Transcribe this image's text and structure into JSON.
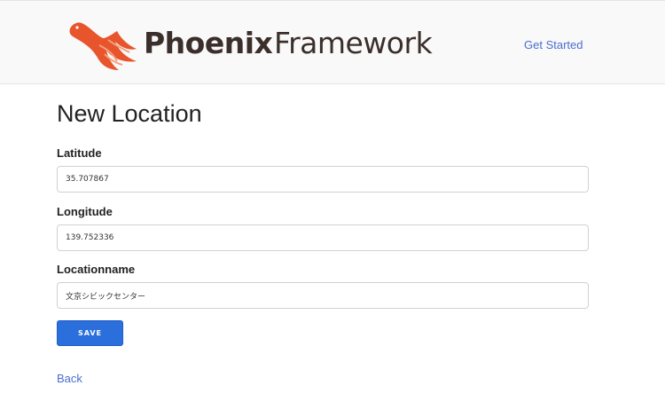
{
  "header": {
    "brand_bold": "Phoenix",
    "brand_light": "Framework",
    "nav_link": "Get Started"
  },
  "main": {
    "title": "New Location",
    "fields": [
      {
        "label": "Latitude",
        "value": "35.707867"
      },
      {
        "label": "Longitude",
        "value": "139.752336"
      },
      {
        "label": "Locationname",
        "value": "文京シビックセンター"
      }
    ],
    "save_label": "SAVE",
    "back_label": "Back"
  },
  "colors": {
    "brand_orange": "#e8542b",
    "link_blue": "#4a6fcf",
    "button_blue": "#2a6fdb",
    "brand_text": "#3b2f2b"
  },
  "icons": {
    "logo": "phoenix-bird-icon"
  }
}
